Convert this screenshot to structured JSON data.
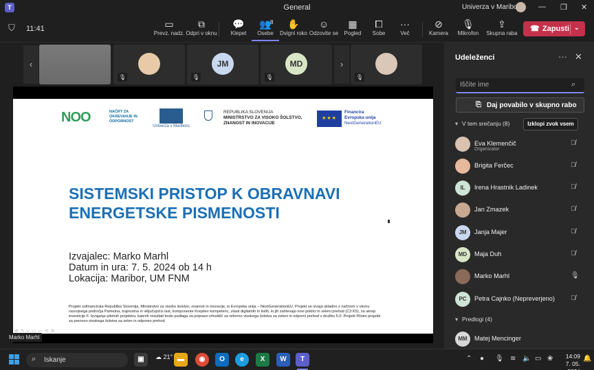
{
  "window": {
    "title": "General",
    "org_name": "Univerza v Mariboru",
    "controls": [
      "—",
      "❐",
      "✕"
    ]
  },
  "toolbar": {
    "timer": "11:41",
    "buttons": [
      {
        "label": "Prevz. nadz.",
        "icon": "take-control-icon"
      },
      {
        "label": "Odpri v oknu",
        "icon": "pop-out-icon"
      },
      {
        "label": "Klepet",
        "icon": "chat-icon"
      },
      {
        "label": "Osebe",
        "icon": "people-icon",
        "badge": "8"
      },
      {
        "label": "Dvigni roko",
        "icon": "raise-hand-icon"
      },
      {
        "label": "Odzovite se",
        "icon": "react-icon"
      },
      {
        "label": "Pogled",
        "icon": "view-icon"
      },
      {
        "label": "Sobe",
        "icon": "rooms-icon"
      },
      {
        "label": "Več",
        "icon": "more-icon"
      }
    ],
    "camera_label": "Kamera",
    "mic_label": "Mikrofon",
    "share_label": "Skupna raba",
    "leave_label": "Zapusti"
  },
  "strip": {
    "tiles": [
      {
        "initials": "",
        "color": "#8e8e8e"
      },
      {
        "initials": "",
        "color": "#e8c9a8"
      },
      {
        "initials": "JM",
        "color": "#c9d8f0"
      },
      {
        "initials": "MD",
        "color": "#d8e6c6"
      },
      {
        "initials": "",
        "color": "#d9c7b8"
      }
    ]
  },
  "slide": {
    "logo_noo": "NOO",
    "logo_noo_caption": "NAČRT ZA OKREVANJE IN ODPORNOST",
    "logo_um_caption": "Univerza v Mariboru",
    "rs_line1": "REPUBLIKA SLOVENIJA",
    "rs_line2": "MINISTRSTVO ZA VISOKO ŠOLSTVO,",
    "rs_line3": "ZNANOST IN INOVACIJE",
    "eu_line1": "Financira",
    "eu_line2": "Evropska unija",
    "eu_line3": "NextGenerationEU",
    "title_line1": "SISTEMSKI PRISTOP K OBRAVNAVI",
    "title_line2": "ENERGETSKE PISMENOSTI",
    "meta_lecturer": "Izvajalec: Marko Marhl",
    "meta_date": "Datum in ura: 7. 5. 2024 ob 14 h",
    "meta_location": "Lokacija: Maribor, UM FNM",
    "footnote": "Projekt sofinancirata Republika Slovenija, Ministrstvo za visoko šolstvo, znanost in inovacije, in Evropska unija – NextGenerationEU. Projekt se izvaja skladno z načrtom v okviru razvojnega področja Pametna, trajnostna in vključujoča rast, komponente Krepitev kompetenc, zlasti digitalnih in tistih, ki jih zahtevajo novi poklici in zeleni prehod (C3 K5), za ukrep investicije F. Izvajanje pilotnih projektov, katerih rezultati bodo podlaga za pripravo izhodišč za reformo visokega šolstva za zeleni in odporni prehod v družbo 5.0: Projekt Pilotni projekti za prenovo visokega šolstva za zelen in odporen prehod."
  },
  "presenter_name": "Marko Marhl",
  "panel": {
    "title": "Udeleženci",
    "search_placeholder": "Iščite ime",
    "invite_label": "Daj povabilo v skupno rabo",
    "in_meeting_label": "V tem srečanju (8)",
    "mute_all_label": "Izklopi zvok vsem",
    "suggestions_label": "Predlogi (4)",
    "participants": [
      {
        "name": "Eva Klemenčič",
        "role": "Organizator",
        "initials": "",
        "color": "#d9c2b0",
        "mic": "muted"
      },
      {
        "name": "Brigita Ferčec",
        "role": "",
        "initials": "",
        "color": "#e6b89c",
        "mic": "muted"
      },
      {
        "name": "Irena Hrastnik Ladinek",
        "role": "",
        "initials": "IL",
        "color": "#cfe3d6",
        "mic": "muted"
      },
      {
        "name": "Jan Zmazek",
        "role": "",
        "initials": "",
        "color": "#c8a890",
        "mic": "muted"
      },
      {
        "name": "Janja Majer",
        "role": "",
        "initials": "JM",
        "color": "#c9d8f0",
        "mic": "muted"
      },
      {
        "name": "Maja Duh",
        "role": "",
        "initials": "MD",
        "color": "#d8e6c6",
        "mic": "muted"
      },
      {
        "name": "Marko Marhl",
        "role": "",
        "initials": "",
        "color": "#8a6a58",
        "mic": "on"
      },
      {
        "name": "Petra Cajnko (Nepreverjeno)",
        "role": "",
        "initials": "PC",
        "color": "#cfe3d6",
        "mic": "muted"
      }
    ],
    "suggestions": [
      {
        "name": "Matej Mencinger",
        "initials": "MM",
        "color": "#d8d8d8"
      }
    ]
  },
  "taskbar": {
    "search_label": "Iskanje",
    "weather": "21°",
    "apps": [
      "file-explorer",
      "chrome",
      "outlook",
      "edge",
      "excel",
      "word",
      "teams"
    ],
    "clock_time": "14:09",
    "clock_date": "7. 05. 2024"
  }
}
